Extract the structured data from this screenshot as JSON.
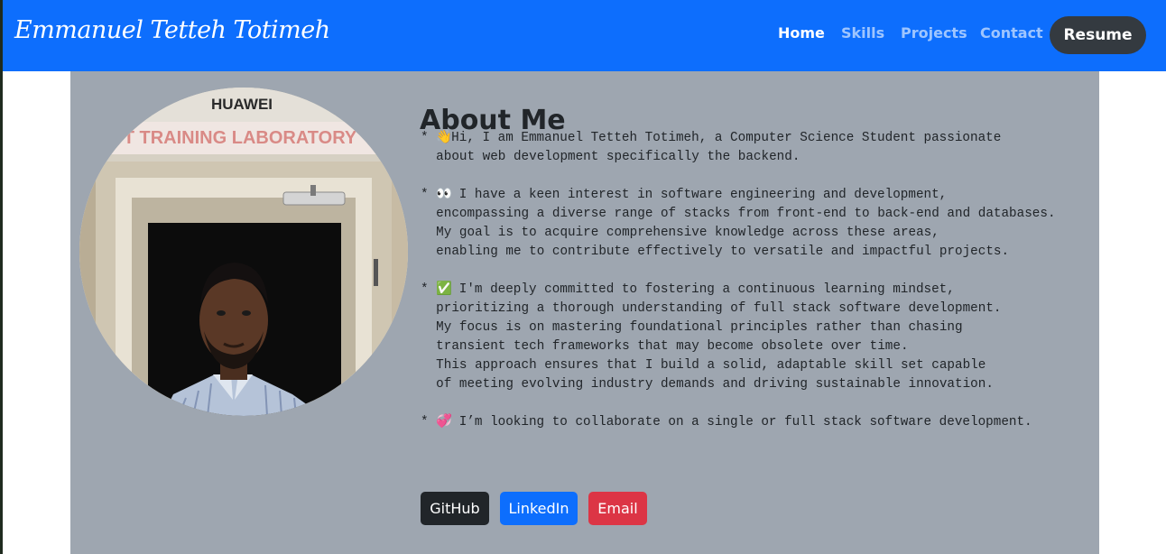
{
  "navbar": {
    "brand": "Emmanuel Tetteh Totimeh",
    "links": [
      {
        "label": "Home",
        "active": true
      },
      {
        "label": "Skills",
        "active": false
      },
      {
        "label": "Projects",
        "active": false
      },
      {
        "label": "Contact",
        "active": false
      }
    ],
    "resume_label": "Resume",
    "background_color": "#0d6efd"
  },
  "about": {
    "title": "About Me",
    "portrait": {
      "sign_text": "HUAWEI",
      "banner_text": "T TRAINING LABORATORY"
    },
    "paragraphs": [
      {
        "emoji": "👋",
        "lines": [
          "Hi, I am Emmanuel Tetteh Totimeh, a Computer Science Student passionate",
          "about web development specifically the backend."
        ]
      },
      {
        "emoji": "👀",
        "lines": [
          " I have a keen interest in software engineering and development,",
          "encompassing a diverse range of stacks from front-end to back-end and databases.",
          "My goal is to acquire comprehensive knowledge across these areas,",
          "enabling me to contribute effectively to versatile and impactful projects."
        ]
      },
      {
        "emoji": "✅",
        "lines": [
          " I'm deeply committed to fostering a continuous learning mindset,",
          "prioritizing a thorough understanding of full stack software development.",
          "My focus is on mastering foundational principles rather than chasing",
          "transient tech frameworks that may become obsolete over time.",
          "This approach ensures that I build a solid, adaptable skill set capable",
          "of meeting evolving industry demands and driving sustainable innovation."
        ]
      },
      {
        "emoji": "💞",
        "lines": [
          " I’m looking to collaborate on a single or full stack software development."
        ]
      }
    ],
    "buttons": {
      "github": "GitHub",
      "linkedin": "LinkedIn",
      "email": "Email"
    },
    "panel_color": "#9ea6b0"
  }
}
